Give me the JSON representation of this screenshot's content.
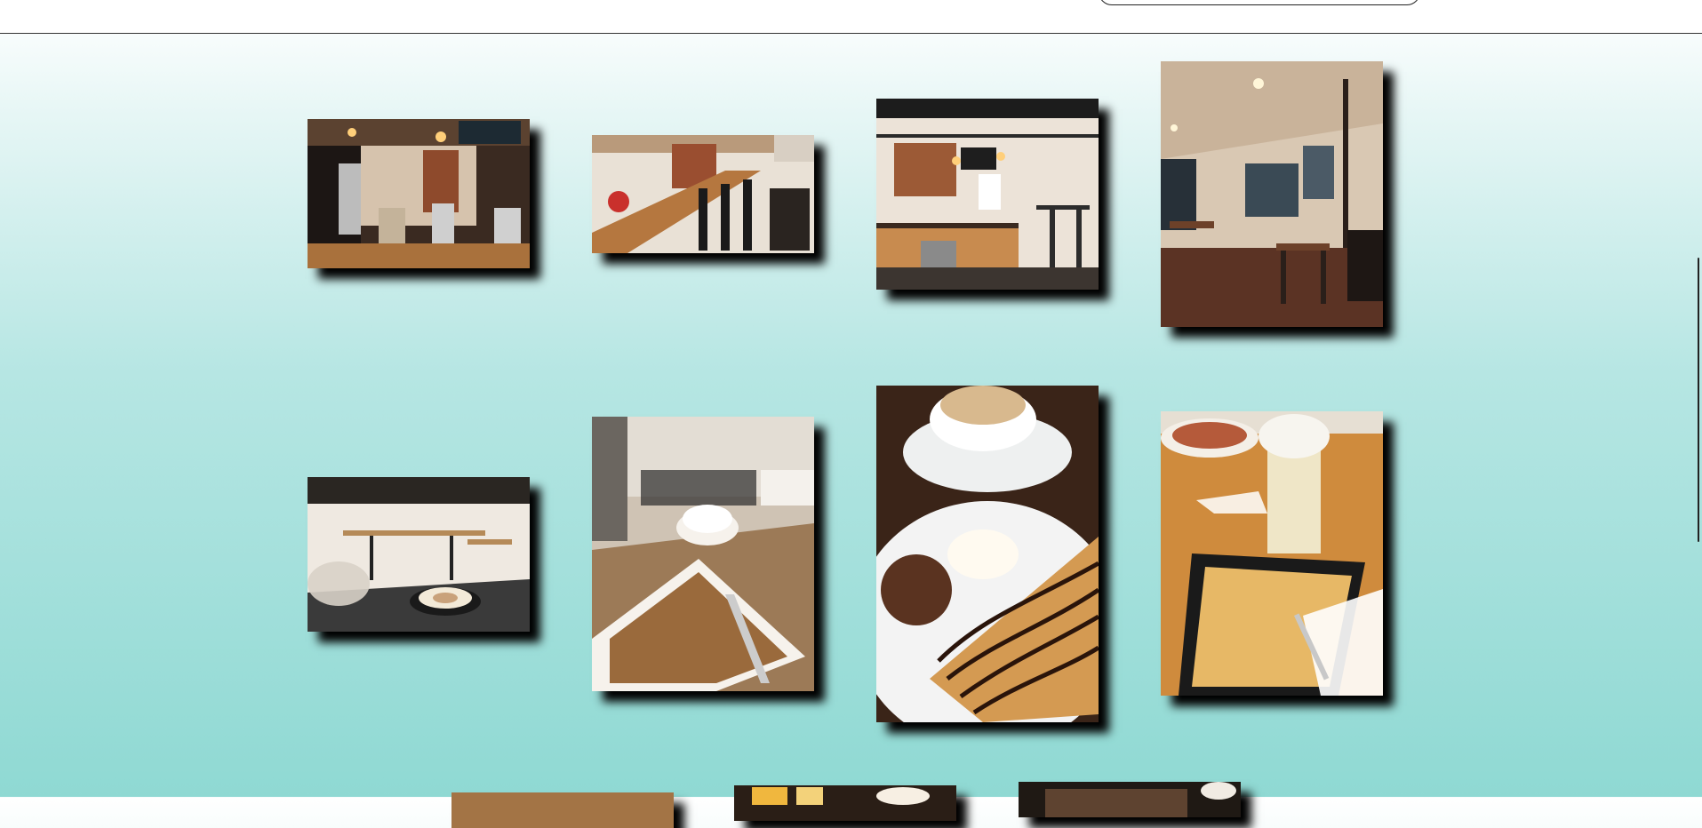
{
  "gallery": {
    "photos": [
      {
        "subject": "coffee-bar-counter-photo",
        "palette": [
          "#2b221c",
          "#8a5a36",
          "#c9a27b",
          "#e8d8c4"
        ]
      },
      {
        "subject": "bar-seating-photo",
        "palette": [
          "#3a2a22",
          "#b07944",
          "#d9c4ad",
          "#f1e8de"
        ]
      },
      {
        "subject": "cafe-interior-photo",
        "palette": [
          "#1e1a18",
          "#7a5633",
          "#cfb290",
          "#efe4d6"
        ]
      },
      {
        "subject": "dining-room-photo",
        "palette": [
          "#2e2019",
          "#6a4934",
          "#d7c2ad",
          "#f4ead8"
        ]
      },
      {
        "subject": "latte-and-cake-photo",
        "palette": [
          "#1c1c1c",
          "#6f5a49",
          "#cbb8a6",
          "#f3efe9"
        ]
      },
      {
        "subject": "dessert-plate-photo",
        "palette": [
          "#3a3026",
          "#8c6b46",
          "#c9b197",
          "#efe9e1"
        ]
      },
      {
        "subject": "crepe-and-coffee-photo",
        "palette": [
          "#2a1a12",
          "#8a5b2f",
          "#d8aa6b",
          "#f6f2ec"
        ]
      },
      {
        "subject": "milkshake-and-crepe-photo",
        "palette": [
          "#241b16",
          "#c48840",
          "#e6c78a",
          "#f3eee4"
        ]
      },
      {
        "subject": "partial-photo-left",
        "palette": [
          "#3b2c22",
          "#a37445",
          "#d7b88c",
          "#ece2d5"
        ]
      },
      {
        "subject": "partial-photo-center",
        "palette": [
          "#2a1e16",
          "#e0a53a",
          "#f3d27a",
          "#f7efe3"
        ]
      },
      {
        "subject": "partial-photo-right",
        "palette": [
          "#1f1914",
          "#5e4330",
          "#bfa286",
          "#f1ebe3"
        ]
      }
    ]
  }
}
